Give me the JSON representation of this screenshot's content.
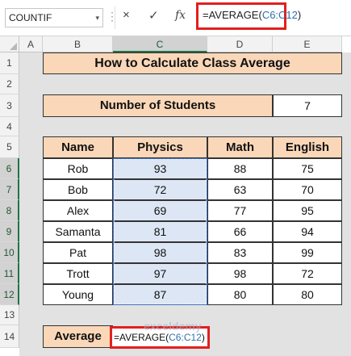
{
  "formula_bar": {
    "name_box": "COUNTIF",
    "cancel_icon": "×",
    "confirm_icon": "✓",
    "fx_label": "fx",
    "formula_prefix": "=AVERAGE(",
    "formula_ref": "C6:C12",
    "formula_suffix": ")"
  },
  "columns": [
    "A",
    "B",
    "C",
    "D",
    "E"
  ],
  "rows": [
    "1",
    "2",
    "3",
    "4",
    "5",
    "6",
    "7",
    "8",
    "9",
    "10",
    "11",
    "12",
    "13",
    "14"
  ],
  "sheet": {
    "title": "How to Calculate Class Average",
    "students_label": "Number of Students",
    "students_value": "7",
    "headers": [
      "Name",
      "Physics",
      "Math",
      "English"
    ],
    "table": [
      {
        "name": "Rob",
        "physics": "93",
        "math": "88",
        "english": "75"
      },
      {
        "name": "Bob",
        "physics": "72",
        "math": "63",
        "english": "70"
      },
      {
        "name": "Alex",
        "physics": "69",
        "math": "77",
        "english": "95"
      },
      {
        "name": "Samanta",
        "physics": "81",
        "math": "66",
        "english": "94"
      },
      {
        "name": "Pat",
        "physics": "98",
        "math": "83",
        "english": "99"
      },
      {
        "name": "Trott",
        "physics": "97",
        "math": "98",
        "english": "72"
      },
      {
        "name": "Young",
        "physics": "87",
        "math": "80",
        "english": "80"
      }
    ],
    "average_label": "Average",
    "average_formula_prefix": "=AVERAGE(",
    "average_formula_ref": "C6:C12",
    "average_formula_suffix": ")"
  },
  "watermark": "exceldemy",
  "colors": {
    "header_fill": "#fad7b8",
    "highlight_border": "#e0201f",
    "selection_fill": "#dce6f4",
    "reference_blue": "#2f6fb0"
  }
}
